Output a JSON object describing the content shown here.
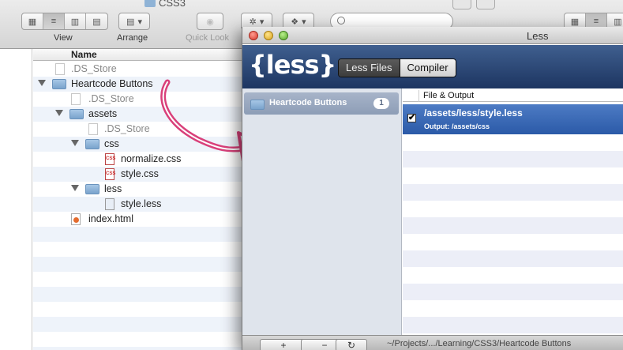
{
  "finder": {
    "title": "CSS3",
    "toolbar": {
      "view_label": "View",
      "arrange_label": "Arrange",
      "quicklook_label": "Quick Look"
    },
    "column_header": "Name",
    "rows": [
      {
        "name": ".DS_Store",
        "dim": true
      },
      {
        "name": "Heartcode Buttons"
      },
      {
        "name": ".DS_Store",
        "dim": true
      },
      {
        "name": "assets"
      },
      {
        "name": ".DS_Store",
        "dim": true
      },
      {
        "name": "css"
      },
      {
        "name": "normalize.css"
      },
      {
        "name": "style.css"
      },
      {
        "name": "less"
      },
      {
        "name": "style.less"
      },
      {
        "name": "index.html"
      }
    ]
  },
  "less_app": {
    "window_title": "Less",
    "logo": "{less}",
    "tabs": [
      "Less Files",
      "Compiler"
    ],
    "project": {
      "name": "Heartcode Buttons",
      "count": "1"
    },
    "column_header": "File & Output",
    "file": {
      "path": "/assets/less/style.less",
      "output": "Output: /assets/css",
      "checked": "✔"
    },
    "bottom": {
      "add": "+",
      "remove": "−",
      "refresh": "↻",
      "path": "~/Projects/.../Learning/CSS3/Heartcode Buttons"
    }
  }
}
